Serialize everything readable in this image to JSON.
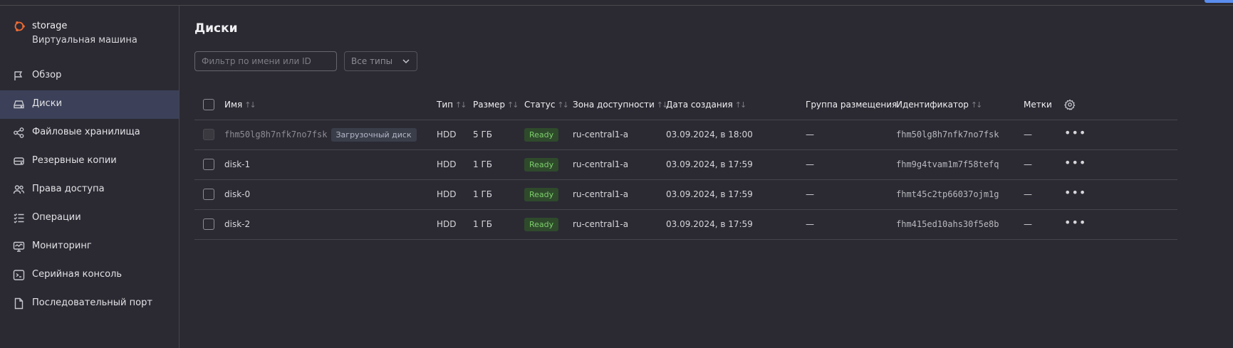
{
  "service": {
    "title": "storage",
    "subtitle": "Виртуальная машина",
    "icon": "ubuntu-icon",
    "accent": "#f06b33"
  },
  "sidebar": {
    "items": [
      {
        "label": "Обзор",
        "icon": "flag-icon",
        "active": false
      },
      {
        "label": "Диски",
        "icon": "disk-icon",
        "active": true
      },
      {
        "label": "Файловые хранилища",
        "icon": "share-icon",
        "active": false
      },
      {
        "label": "Резервные копии",
        "icon": "backup-icon",
        "active": false
      },
      {
        "label": "Права доступа",
        "icon": "users-icon",
        "active": false
      },
      {
        "label": "Операции",
        "icon": "list-check-icon",
        "active": false
      },
      {
        "label": "Мониторинг",
        "icon": "monitor-icon",
        "active": false
      },
      {
        "label": "Серийная консоль",
        "icon": "terminal-icon",
        "active": false
      },
      {
        "label": "Последовательный порт",
        "icon": "file-icon",
        "active": false
      }
    ]
  },
  "page": {
    "title": "Диски",
    "filter_placeholder": "Фильтр по имени или ID",
    "type_select": "Все типы"
  },
  "table": {
    "columns": {
      "name": "Имя",
      "type": "Тип",
      "size": "Размер",
      "status": "Статус",
      "zone": "Зона доступности",
      "created": "Дата создания",
      "placement": "Группа размещения",
      "id": "Идентификатор",
      "labels": "Метки"
    },
    "rows": [
      {
        "name": "fhm50lg8h7nfk7no7fsk",
        "badge": "Загрузочный диск",
        "type": "HDD",
        "size": "5 ГБ",
        "status": "Ready",
        "zone": "ru-central1-a",
        "created": "03.09.2024, в 18:00",
        "placement": "—",
        "id": "fhm50lg8h7nfk7no7fsk",
        "labels": "—"
      },
      {
        "name": "disk-1",
        "badge": "",
        "type": "HDD",
        "size": "1 ГБ",
        "status": "Ready",
        "zone": "ru-central1-a",
        "created": "03.09.2024, в 17:59",
        "placement": "—",
        "id": "fhm9g4tvam1m7f58tefq",
        "labels": "—"
      },
      {
        "name": "disk-0",
        "badge": "",
        "type": "HDD",
        "size": "1 ГБ",
        "status": "Ready",
        "zone": "ru-central1-a",
        "created": "03.09.2024, в 17:59",
        "placement": "—",
        "id": "fhmt45c2tp66037ojm1g",
        "labels": "—"
      },
      {
        "name": "disk-2",
        "badge": "",
        "type": "HDD",
        "size": "1 ГБ",
        "status": "Ready",
        "zone": "ru-central1-a",
        "created": "03.09.2024, в 17:59",
        "placement": "—",
        "id": "fhm415ed10ahs30f5e8b",
        "labels": "—"
      }
    ]
  },
  "colors": {
    "status_ready_bg": "#2e4a2b",
    "status_ready_text": "#7ecf6d",
    "active_nav": "#3c4159"
  }
}
